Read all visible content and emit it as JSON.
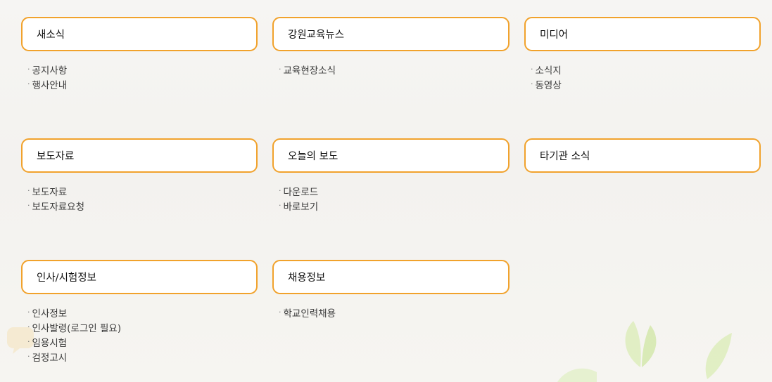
{
  "categories": [
    {
      "title": "새소식",
      "items": [
        "공지사항",
        "행사안내"
      ]
    },
    {
      "title": "강원교육뉴스",
      "items": [
        "교육현장소식"
      ]
    },
    {
      "title": "미디어",
      "items": [
        "소식지",
        "동영상"
      ]
    },
    {
      "title": "보도자료",
      "items": [
        "보도자료",
        "보도자료요청"
      ]
    },
    {
      "title": "오늘의 보도",
      "items": [
        "다운로드",
        "바로보기"
      ]
    },
    {
      "title": "타기관 소식",
      "items": []
    },
    {
      "title": "인사/시험정보",
      "items": [
        "인사정보",
        "인사발령(로그인 필요)",
        "임용시험",
        "검정고시"
      ]
    },
    {
      "title": "채용정보",
      "items": [
        "학교인력채용"
      ]
    }
  ],
  "colors": {
    "accent": "#f1a22c",
    "background": "#f4f3f0",
    "leaf": "#d4e9a8"
  },
  "bullet": "·"
}
